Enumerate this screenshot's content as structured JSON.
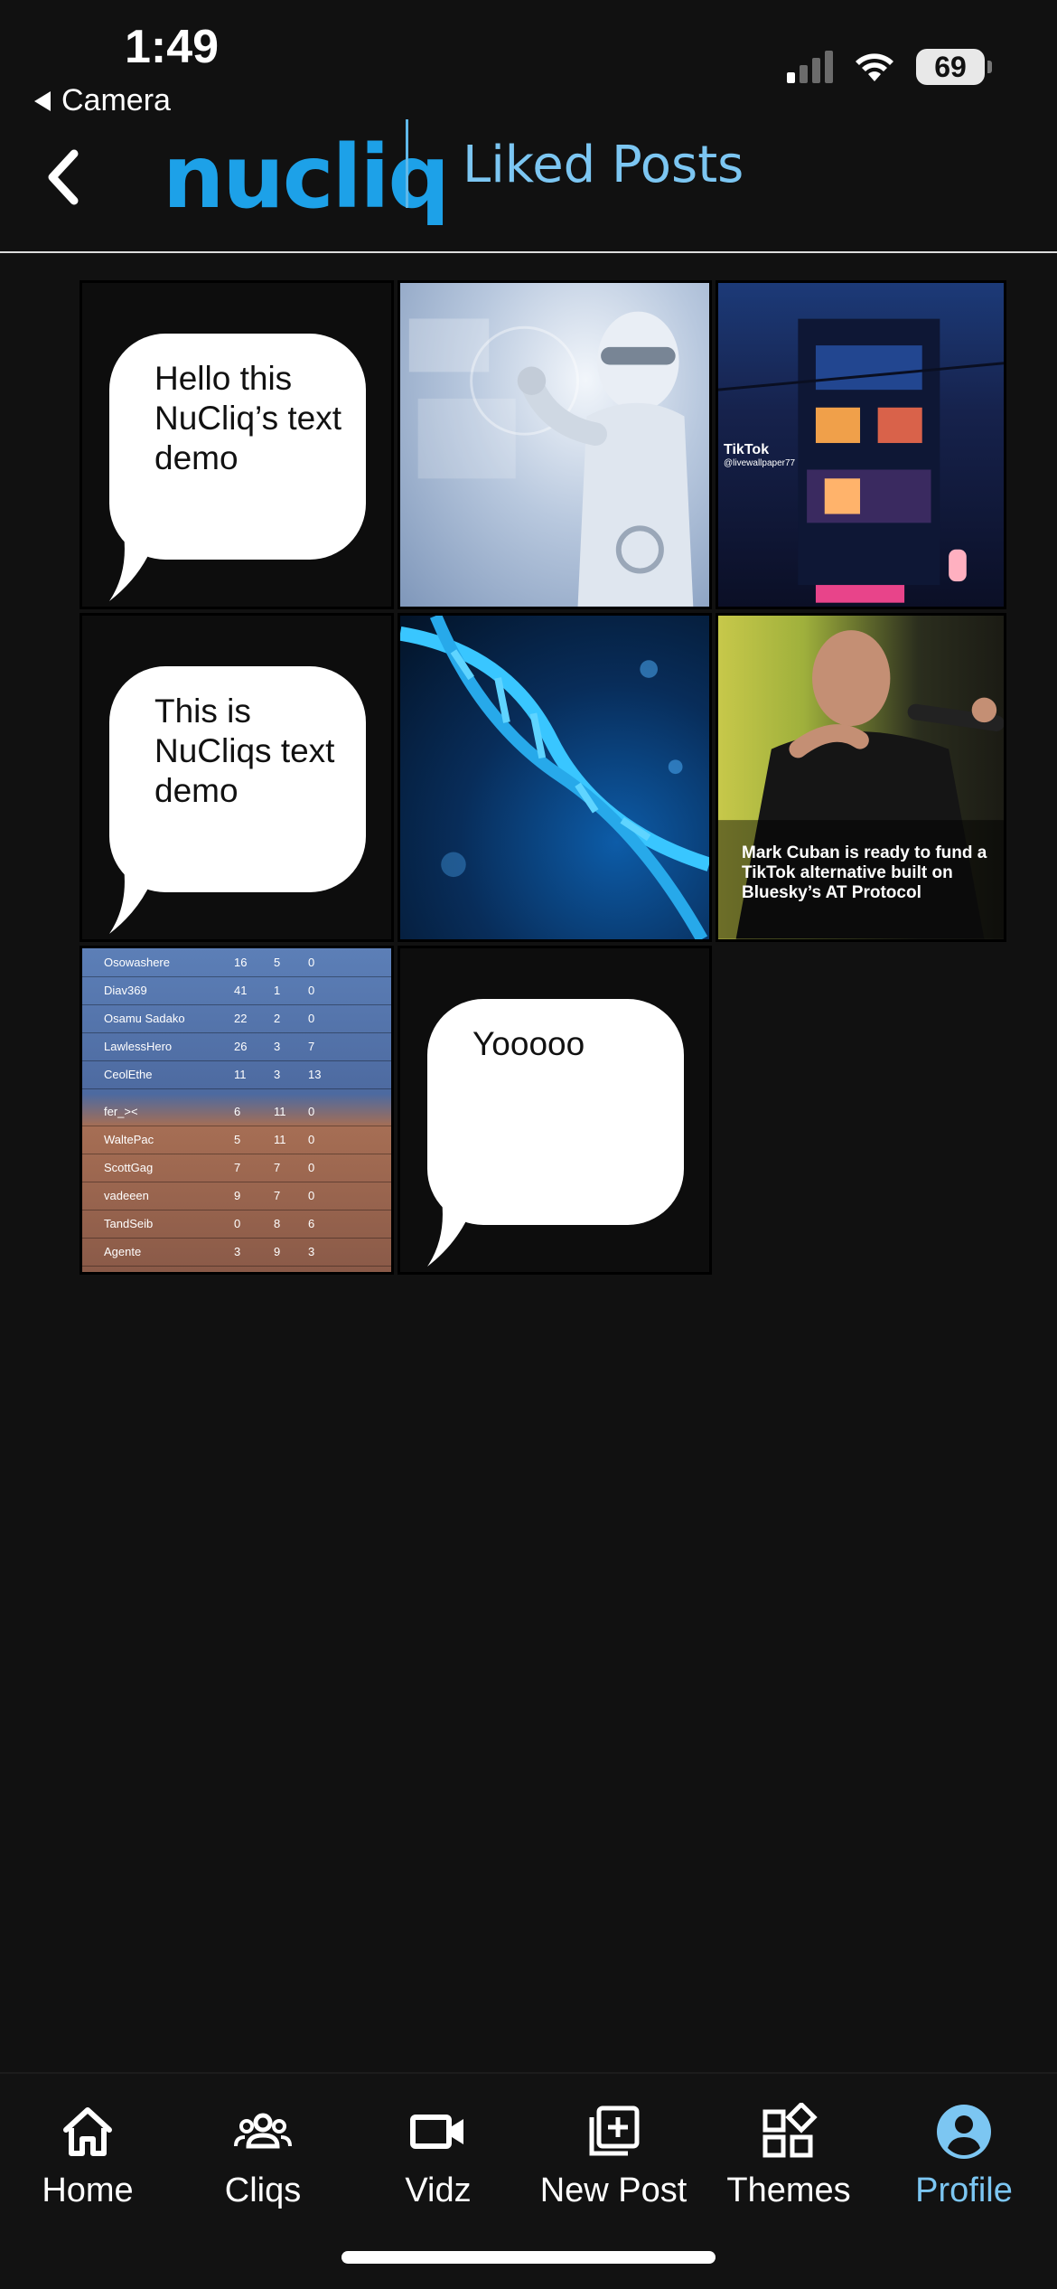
{
  "status_bar": {
    "time": "1:49",
    "back_label": "Camera",
    "battery": "69"
  },
  "header": {
    "logo": "nucliq",
    "title": "Liked Posts"
  },
  "posts": {
    "text1": "Hello this NuCliq’s text demo",
    "text2": "This is NuCliqs text demo",
    "text3": "Yooooo",
    "cuban_caption": "Mark Cuban is ready to fund a TikTok alternative built on Bluesky’s AT Protocol",
    "tiktok_watermark": "TikTok",
    "tiktok_handle": "@livewallpaper77",
    "scoreboard": [
      {
        "name": "Osowashere",
        "k": "16",
        "d": "5",
        "a": "0"
      },
      {
        "name": "Diav369",
        "k": "41",
        "d": "1",
        "a": "0"
      },
      {
        "name": "Osamu Sadako",
        "k": "22",
        "d": "2",
        "a": "0"
      },
      {
        "name": "LawlessHero",
        "k": "26",
        "d": "3",
        "a": "7"
      },
      {
        "name": "CeolEthe",
        "k": "11",
        "d": "3",
        "a": "13"
      },
      {
        "name": "fer_><",
        "k": "6",
        "d": "11",
        "a": "0"
      },
      {
        "name": "WaltePac",
        "k": "5",
        "d": "11",
        "a": "0"
      },
      {
        "name": "ScottGag",
        "k": "7",
        "d": "7",
        "a": "0"
      },
      {
        "name": "vadeeen",
        "k": "9",
        "d": "7",
        "a": "0"
      },
      {
        "name": "TandSeib",
        "k": "0",
        "d": "8",
        "a": "6"
      },
      {
        "name": "Agente",
        "k": "3",
        "d": "9",
        "a": "3"
      }
    ]
  },
  "nav": {
    "items": [
      {
        "label": "Home",
        "icon": "home-icon"
      },
      {
        "label": "Cliqs",
        "icon": "group-icon"
      },
      {
        "label": "Vidz",
        "icon": "video-camera-icon"
      },
      {
        "label": "New Post",
        "icon": "add-post-icon"
      },
      {
        "label": "Themes",
        "icon": "themes-grid-icon"
      },
      {
        "label": "Profile",
        "icon": "profile-icon"
      }
    ],
    "active": "Profile"
  },
  "colors": {
    "accent": "#1da1e8",
    "title": "#7cc6f2",
    "background": "#111111"
  }
}
